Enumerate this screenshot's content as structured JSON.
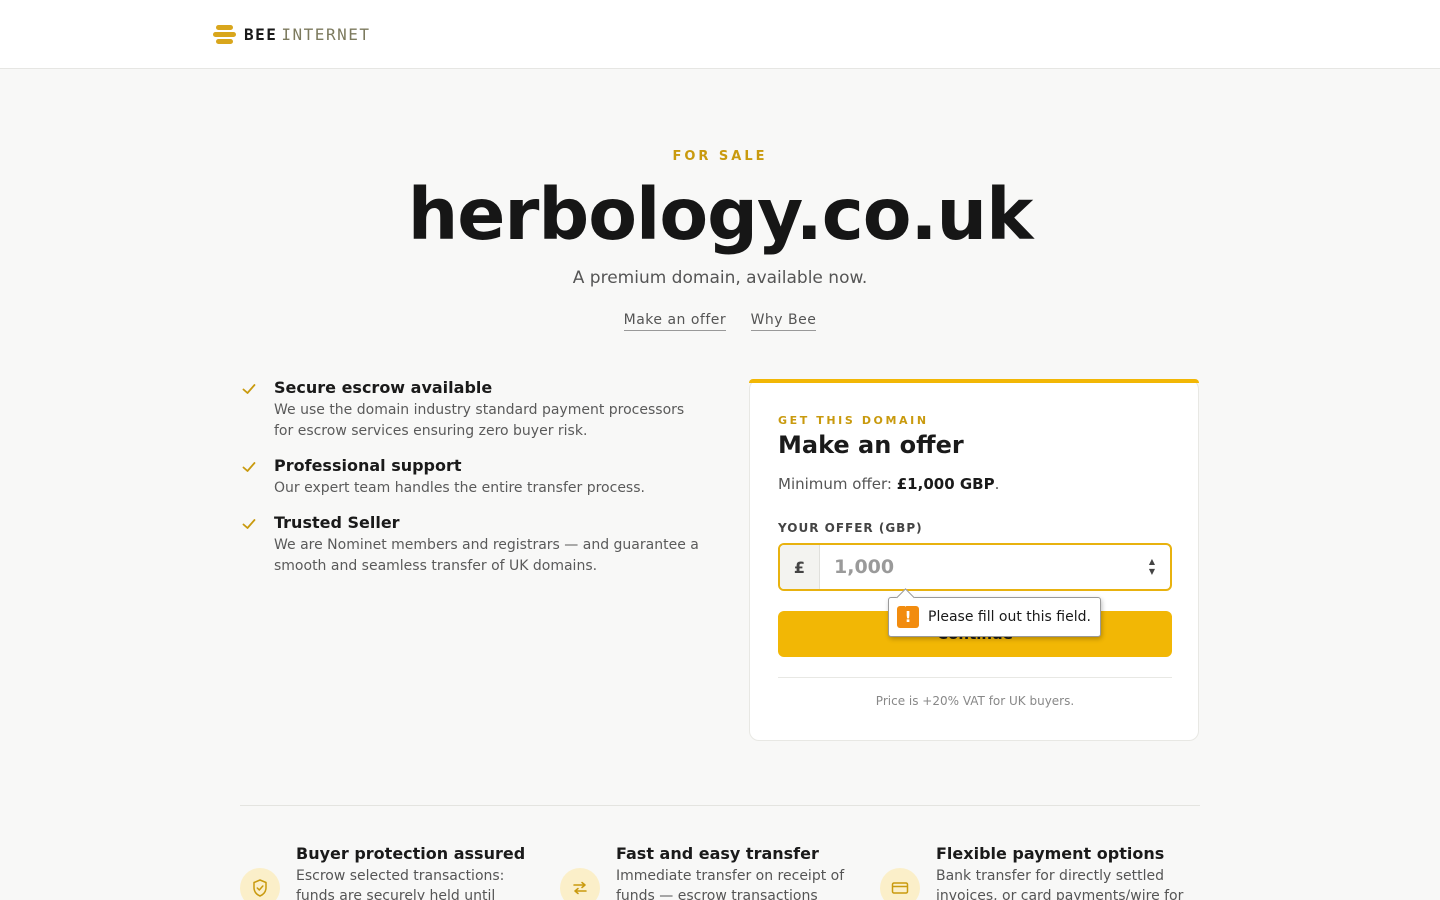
{
  "brand": {
    "name_bold": "BEE",
    "name_light": "INTERNET"
  },
  "hero": {
    "eyebrow": "FOR SALE",
    "domain": "herbology.co.uk",
    "subtitle": "A premium domain, available now.",
    "links": [
      "Make an offer",
      "Why Bee"
    ]
  },
  "features": [
    {
      "title": "Secure escrow available",
      "text": "We use the domain industry standard payment processors for escrow services ensuring zero buyer risk."
    },
    {
      "title": "Professional support",
      "text": "Our expert team handles the entire transfer process."
    },
    {
      "title": "Trusted Seller",
      "text": "We are Nominet members and registrars — and guarantee a smooth and seamless transfer of UK domains."
    }
  ],
  "offer_card": {
    "eyebrow": "GET THIS DOMAIN",
    "title": "Make an offer",
    "min_prefix": "Minimum offer: ",
    "min_amount": "£1,000 GBP",
    "min_suffix": ".",
    "field_label": "YOUR OFFER (GBP)",
    "currency_symbol": "£",
    "input_placeholder": "1,000",
    "input_value": "",
    "continue_label": "Continue",
    "vat_note": "Price is +20% VAT for UK buyers."
  },
  "validation_tooltip": {
    "message": "Please fill out this field."
  },
  "benefits": [
    {
      "icon": "shield-check-icon",
      "title": "Buyer protection assured",
      "text": "Escrow selected transactions: funds are securely held until"
    },
    {
      "icon": "swap-arrows-icon",
      "title": "Fast and easy transfer",
      "text": "Immediate transfer on receipt of funds — escrow transactions"
    },
    {
      "icon": "credit-card-icon",
      "title": "Flexible payment options",
      "text": "Bank transfer for directly settled invoices, or card payments/wire for"
    }
  ],
  "colors": {
    "accent": "#f2b705",
    "accent_text": "#c99a0e",
    "warning": "#f28c0f"
  }
}
